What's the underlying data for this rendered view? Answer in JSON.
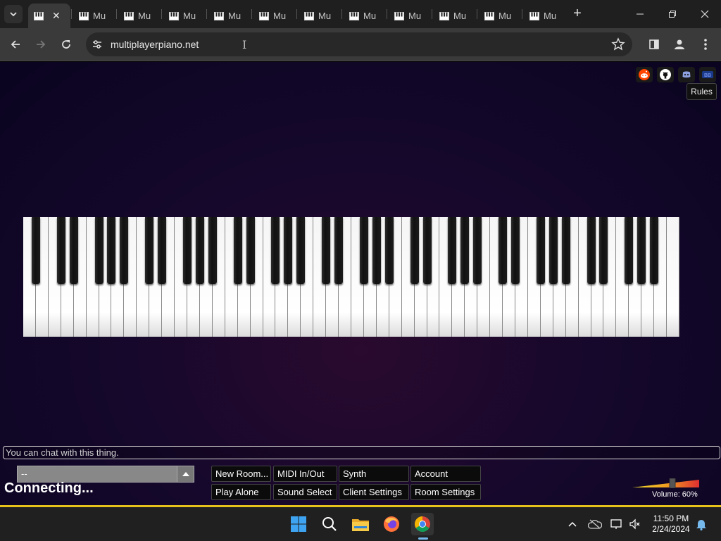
{
  "browser": {
    "tab_title": "Mu",
    "tab_count": 12,
    "url": "multiplayerpiano.net"
  },
  "page": {
    "social_icons": [
      "reddit-icon",
      "github-icon",
      "discord-icon",
      "forum-icon"
    ],
    "tooltip": "Rules",
    "chat_placeholder": "You can chat with this thing.",
    "room_select_value": "--",
    "status": "Connecting...",
    "buttons": {
      "new_room": "New Room...",
      "midi": "MIDI In/Out",
      "synth": "Synth",
      "account": "Account",
      "play_alone": "Play Alone",
      "sound_select": "Sound Select",
      "client_settings": "Client Settings",
      "room_settings": "Room Settings"
    },
    "volume": {
      "label": "Volume: 60%",
      "level": 0.6
    }
  },
  "taskbar": {
    "time": "11:50 PM",
    "date": "2/24/2024",
    "apps": [
      "start-icon",
      "search-icon",
      "file-explorer-icon",
      "firefox-icon",
      "chrome-icon"
    ]
  },
  "colors": {
    "accent_bar": "#e6c21a",
    "page_bg": "#16082c"
  }
}
